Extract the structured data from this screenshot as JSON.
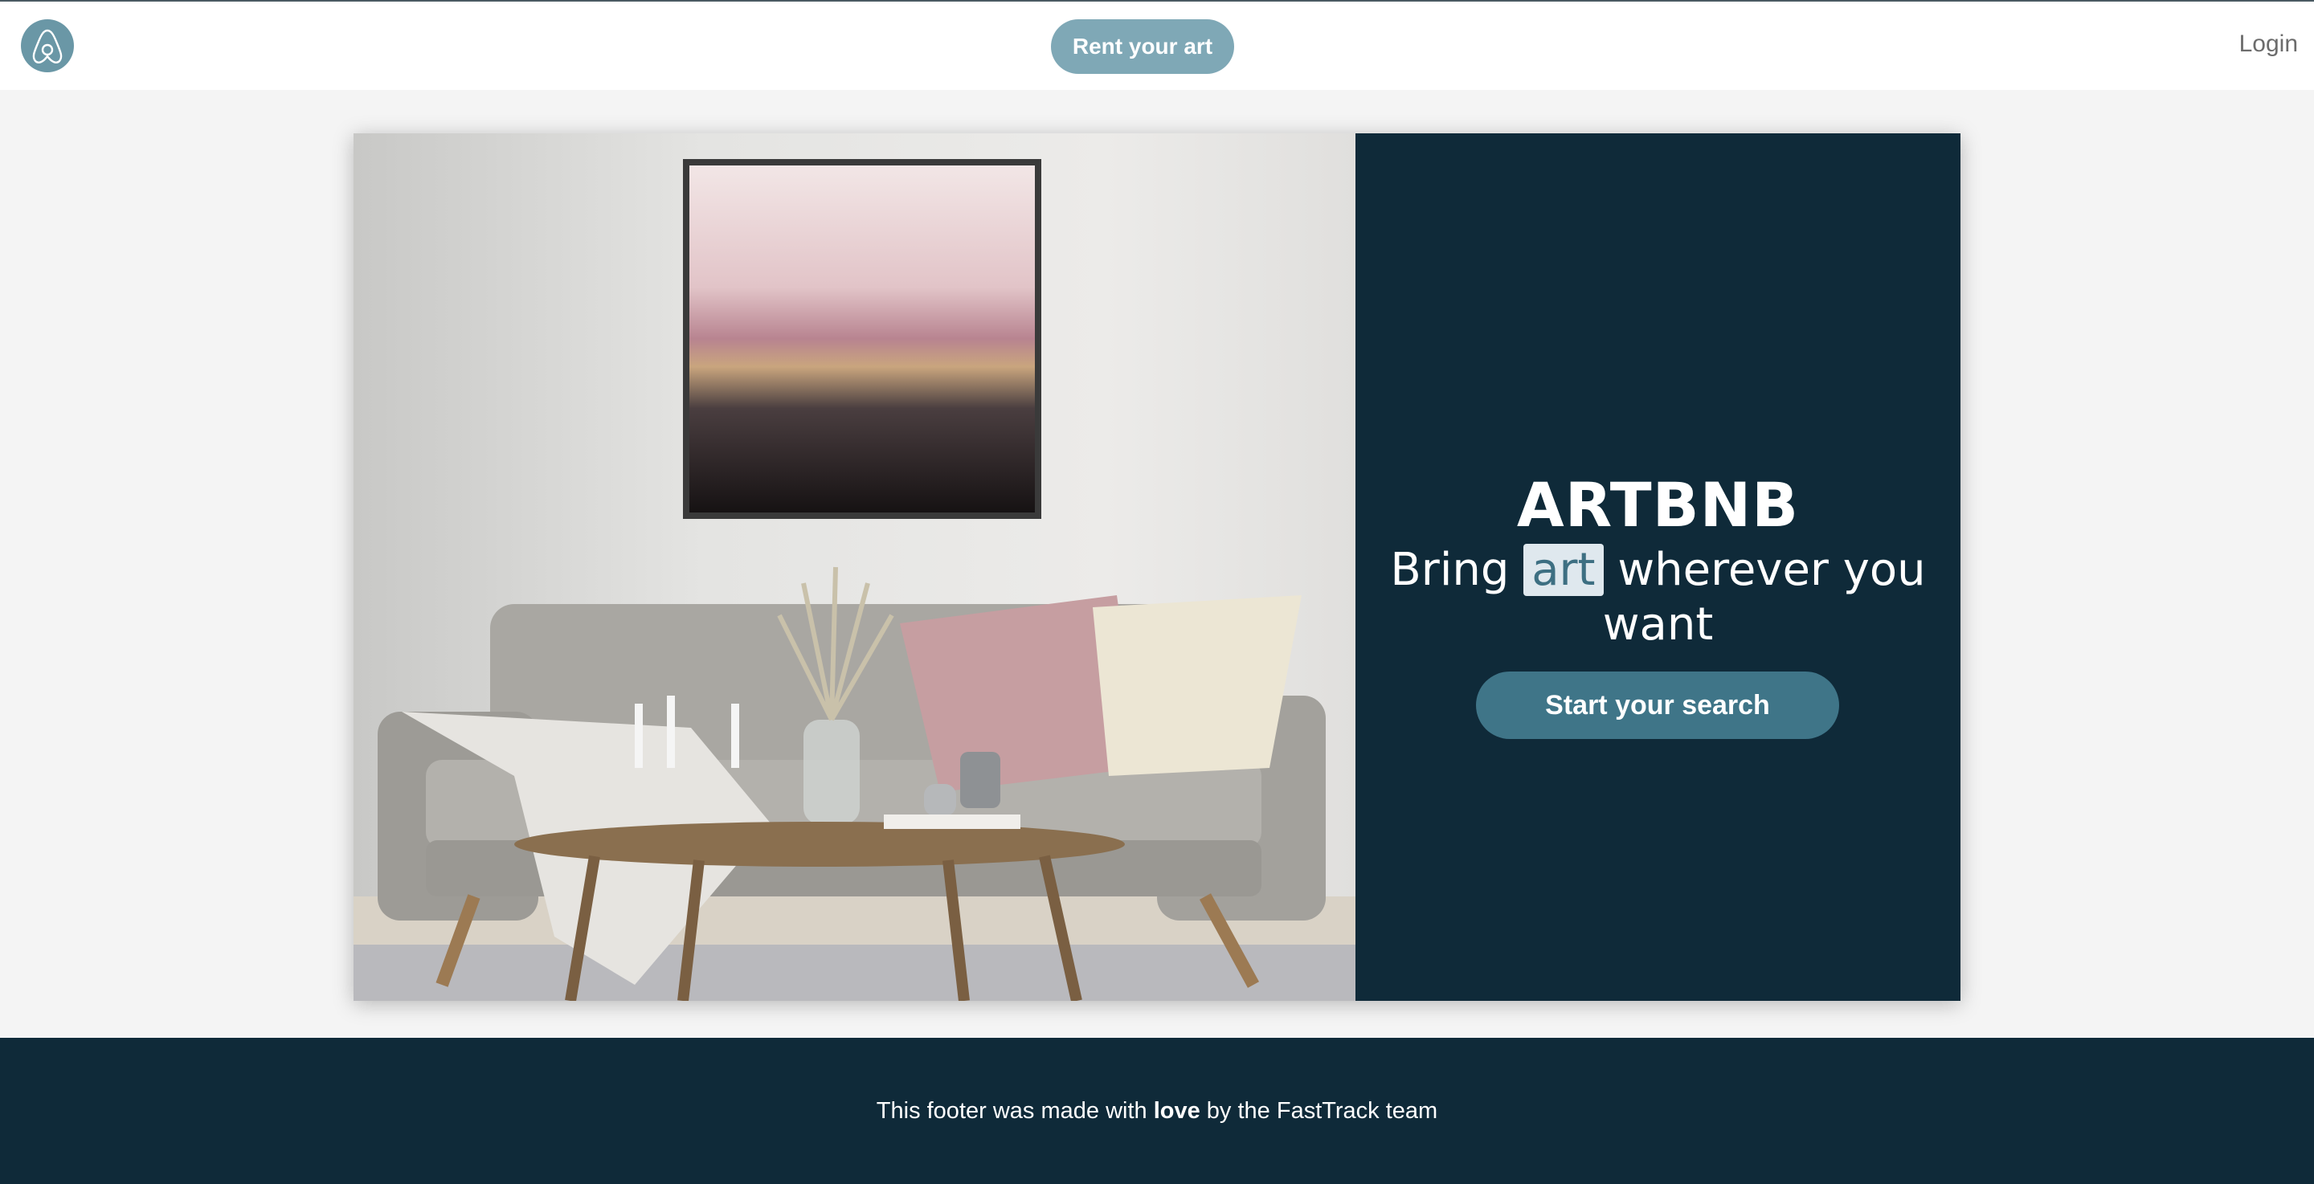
{
  "navbar": {
    "logo_icon": "airbnb-logo-icon",
    "rent_label": "Rent your art",
    "login_label": "Login"
  },
  "hero": {
    "brand": "ARTBNB",
    "tagline_before": "Bring ",
    "tagline_highlight": "art",
    "tagline_after": " wherever you want",
    "search_label": "Start your search",
    "image": "living-room-with-framed-art-and-sofa"
  },
  "footer": {
    "text_before": "This footer was made with ",
    "text_bold": "love",
    "text_after": " by the FastTrack team"
  },
  "colors": {
    "accent": "#3f7588",
    "accent_light": "#7fa8b6",
    "dark": "#0f2a39",
    "background": "#f4f4f4"
  }
}
